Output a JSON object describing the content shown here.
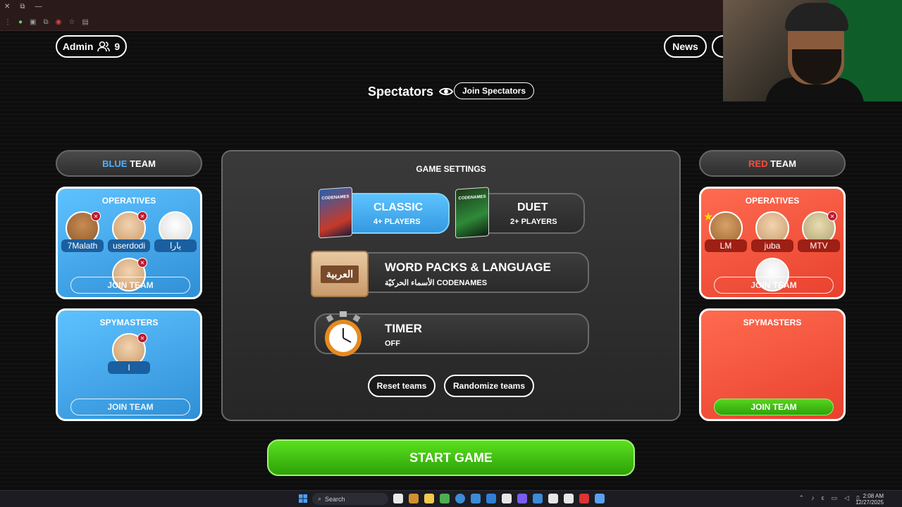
{
  "browser": {
    "icons": [
      "close-icon",
      "restore-icon",
      "minimize-icon"
    ]
  },
  "header": {
    "admin_label": "Admin",
    "player_count": "9",
    "news_label": "News",
    "spectators_label": "Spectators",
    "join_spectators_label": "Join Spectators"
  },
  "blue_team": {
    "title_colored": "BLUE",
    "title_rest": " TEAM",
    "operatives_title": "OPERATIVES",
    "operatives": [
      {
        "name": "7Malath"
      },
      {
        "name": "userdodi"
      },
      {
        "name": "يارا"
      },
      {
        "name": ""
      }
    ],
    "operatives_join": "JOIN TEAM",
    "spymasters_title": "SPYMASTERS",
    "spymasters": [
      {
        "name": "I"
      }
    ],
    "spymasters_join": "JOIN TEAM"
  },
  "red_team": {
    "title_colored": "RED",
    "title_rest": " TEAM",
    "operatives_title": "OPERATIVES",
    "operatives": [
      {
        "name": "LM"
      },
      {
        "name": "juba"
      },
      {
        "name": "MTV"
      },
      {
        "name": ""
      }
    ],
    "operatives_join": "JOIN TEAM",
    "spymasters_title": "SPYMASTERS",
    "spymasters_join": "JOIN TEAM"
  },
  "settings": {
    "title": "GAME SETTINGS",
    "classic": {
      "label": "CLASSIC",
      "sub": "4+ PLAYERS",
      "box_text": "CODENAMES"
    },
    "duet": {
      "label": "DUET",
      "sub": "2+ PLAYERS",
      "box_text": "CODENAMES"
    },
    "word_packs": {
      "label": "WORD PACKS & LANGUAGE",
      "sub": "الأسماء الحركيّة CODENAMES",
      "badge": "العربية"
    },
    "timer": {
      "label": "TIMER",
      "sub": "OFF"
    },
    "reset_label": "Reset teams",
    "randomize_label": "Randomize teams"
  },
  "start_label": "START GAME",
  "taskbar": {
    "search_label": "Search",
    "time": "2:08 AM",
    "date": "12/27/2025",
    "icon_colors": [
      "#e8e8e8",
      "#d28f2f",
      "#f2c94c",
      "#4caf50",
      "#3b8bd6",
      "#3b8bd6",
      "#2f7fd6",
      "#e6e6e6",
      "#7a5cf0",
      "#3b8bd6",
      "#e6e6e6",
      "#e6e6e6",
      "#d33",
      "#5aa0f0"
    ]
  }
}
